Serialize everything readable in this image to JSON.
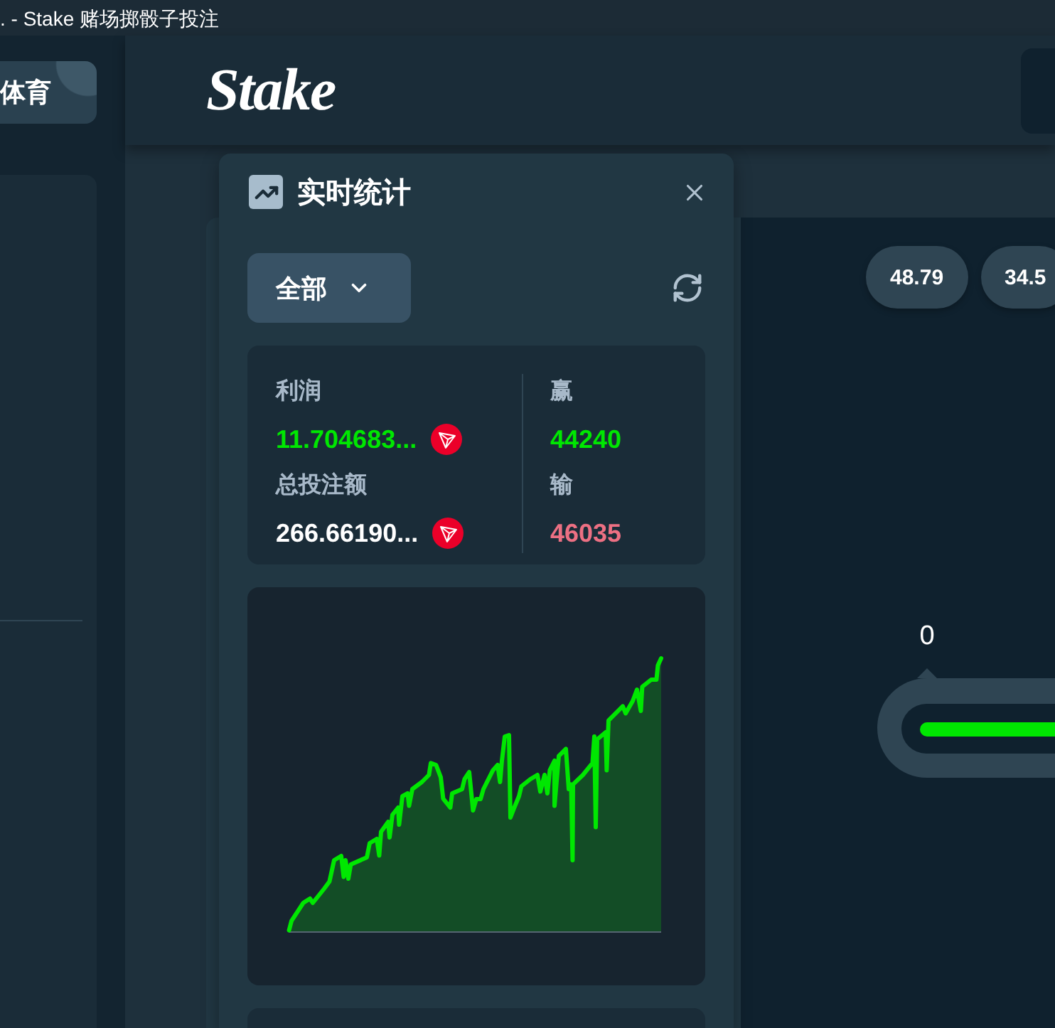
{
  "window": {
    "title": ". - Stake 赌场掷骰子投注"
  },
  "sidebar": {
    "sports_button": "体育"
  },
  "header": {
    "logo": "Stake"
  },
  "stats_panel": {
    "title": "实时统计",
    "filter": "全部",
    "columns": [
      {
        "items": [
          {
            "label": "利润",
            "value": "11.704683...",
            "color": "#00e701",
            "coin": true
          },
          {
            "label": "总投注额",
            "value": "266.66190...",
            "color": "#ffffff",
            "coin": true
          }
        ]
      },
      {
        "items": [
          {
            "label": "赢",
            "value": "44240",
            "color": "#00e701",
            "coin": false
          },
          {
            "label": "输",
            "value": "46035",
            "color": "#ed7083",
            "coin": false
          }
        ]
      }
    ]
  },
  "game": {
    "results": [
      "48.79",
      "34.5"
    ],
    "slider": {
      "marker": "0"
    }
  }
}
